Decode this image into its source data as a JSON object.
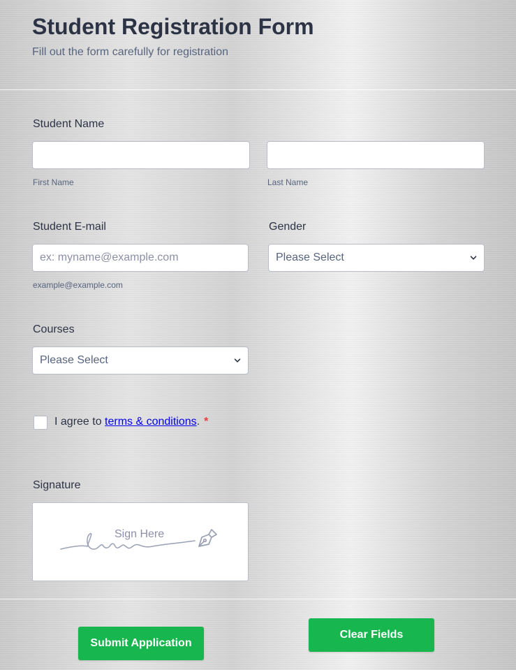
{
  "form": {
    "title": "Student Registration Form",
    "subtitle": "Fill out the form carefully for registration"
  },
  "student_name": {
    "label": "Student Name",
    "first_name": {
      "value": "",
      "sublabel": "First Name"
    },
    "last_name": {
      "value": "",
      "sublabel": "Last Name"
    }
  },
  "email": {
    "label": "Student E-mail",
    "value": "",
    "placeholder": "ex: myname@example.com",
    "sublabel": "example@example.com"
  },
  "gender": {
    "label": "Gender",
    "selected": "Please Select"
  },
  "courses": {
    "label": "Courses",
    "selected": "Please Select"
  },
  "terms": {
    "prefix": "I agree to ",
    "link_text": "terms & conditions",
    "suffix": ".",
    "required_mark": "*",
    "checked": false
  },
  "signature": {
    "label": "Signature",
    "placeholder": "Sign Here",
    "icon": "pen-nib-icon"
  },
  "buttons": {
    "submit": "Submit Application",
    "clear": "Clear Fields"
  },
  "colors": {
    "button": "#18b64e",
    "link": "#0000ee",
    "required": "#f23a3c",
    "title": "#2c3345"
  }
}
